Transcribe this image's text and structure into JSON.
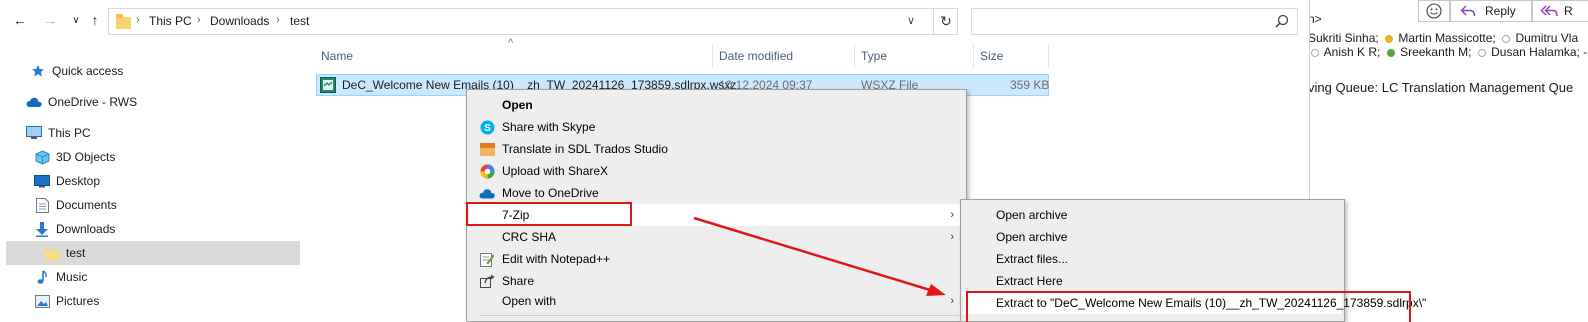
{
  "explorer": {
    "nav": {
      "back": "←",
      "forward": "→",
      "up": "↑",
      "recent": "∨"
    },
    "address": {
      "crumbs": [
        "This PC",
        "Downloads",
        "test"
      ],
      "separator": "›",
      "dropdown": "∨",
      "refresh": "↻"
    },
    "search": {
      "placeholder": ""
    },
    "navpane": {
      "items": [
        {
          "label": "Quick access",
          "icon": "star-icon"
        },
        {
          "label": "OneDrive - RWS",
          "icon": "cloud-icon"
        },
        {
          "label": "This PC",
          "icon": "computer-icon"
        },
        {
          "label": "3D Objects",
          "icon": "cube-icon"
        },
        {
          "label": "Desktop",
          "icon": "desktop-icon"
        },
        {
          "label": "Documents",
          "icon": "document-icon"
        },
        {
          "label": "Downloads",
          "icon": "download-icon"
        },
        {
          "label": "test",
          "icon": "folder-icon",
          "selected": true
        },
        {
          "label": "Music",
          "icon": "music-icon"
        },
        {
          "label": "Pictures",
          "icon": "pictures-icon"
        }
      ]
    },
    "columns": {
      "name": "Name",
      "date": "Date modified",
      "type": "Type",
      "size": "Size",
      "sort_indicator": "^"
    },
    "files": [
      {
        "name": "DeC_Welcome New Emails (10)__zh_TW_20241126_173859.sdlrpx.wsxz",
        "date": "10.12.2024 09:37",
        "type": "WSXZ File",
        "size": "359 KB"
      }
    ]
  },
  "context_menu": {
    "items": [
      {
        "label": "Open",
        "bold": true
      },
      {
        "label": "Share with Skype",
        "icon": "skype-icon"
      },
      {
        "label": "Translate in SDL Trados Studio",
        "icon": "trados-icon"
      },
      {
        "label": "Upload with ShareX",
        "icon": "sharex-icon"
      },
      {
        "label": "Move to OneDrive",
        "icon": "onedrive-icon"
      },
      {
        "label": "7-Zip",
        "submenu": true,
        "highlighted": true
      },
      {
        "label": "CRC SHA",
        "submenu": true
      },
      {
        "label": "Edit with Notepad++",
        "icon": "notepadpp-icon"
      },
      {
        "label": "Share",
        "icon": "share-icon"
      },
      {
        "label": "Open with",
        "submenu": true
      }
    ],
    "submenu_arrow": "›"
  },
  "sevenzip_submenu": {
    "items": [
      {
        "label": "Open archive"
      },
      {
        "label": "Open archive"
      },
      {
        "label": "Extract files..."
      },
      {
        "label": "Extract Here"
      },
      {
        "label": "Extract to \"DeC_Welcome New Emails (10)__zh_TW_20241126_173859.sdlrpx\\\"",
        "highlighted": true
      }
    ]
  },
  "outlook": {
    "reply_label": "Reply",
    "reply_all_label": "R",
    "partial_header": "n>",
    "recipients_line1": [
      "Sukriti Sinha;",
      "Martin Massicotte;",
      "Dumitru Vla"
    ],
    "recipients_line2": [
      "Anish K R;",
      "Sreekanth M;",
      "Dusan Halamka; -"
    ],
    "queue_text": "ving Queue: LC Translation Management Que",
    "colors": {
      "status_away": "#e6b422",
      "status_available": "#5ba63a",
      "status_offline": "#aaaaaa"
    }
  },
  "colors": {
    "selection": "#cce8ff",
    "annotation_red": "#e0161b"
  }
}
